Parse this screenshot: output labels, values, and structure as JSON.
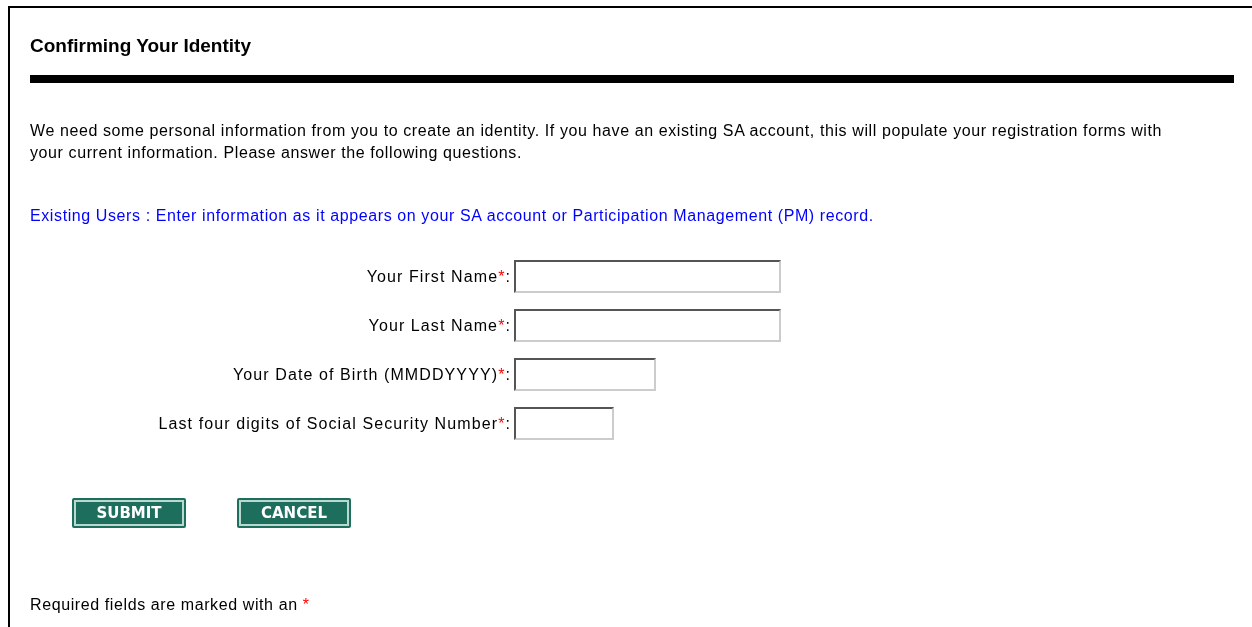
{
  "heading": "Confirming Your Identity",
  "intro": "We need some personal information from you to create an identity. If you have an existing SA account, this will populate your registration forms with your current information. Please answer the following questions.",
  "notice": "Existing Users : Enter information as it appears on your SA account or Participation Management (PM) record.",
  "fields": [
    {
      "label": "Your First Name",
      "mark": "*",
      "suffix": ":"
    },
    {
      "label": "Your Last Name",
      "mark": "*",
      "suffix": ":"
    },
    {
      "label": "Your Date of Birth (MMDDYYYY)",
      "mark": "*",
      "suffix": ":"
    },
    {
      "label": "Last four digits of Social Security Number",
      "mark": "*",
      "suffix": ":"
    }
  ],
  "buttons": [
    {
      "label": "SUBMIT"
    },
    {
      "label": "CANCEL"
    }
  ],
  "footnote": {
    "text": "Required fields are marked with an",
    "mark": "*"
  }
}
